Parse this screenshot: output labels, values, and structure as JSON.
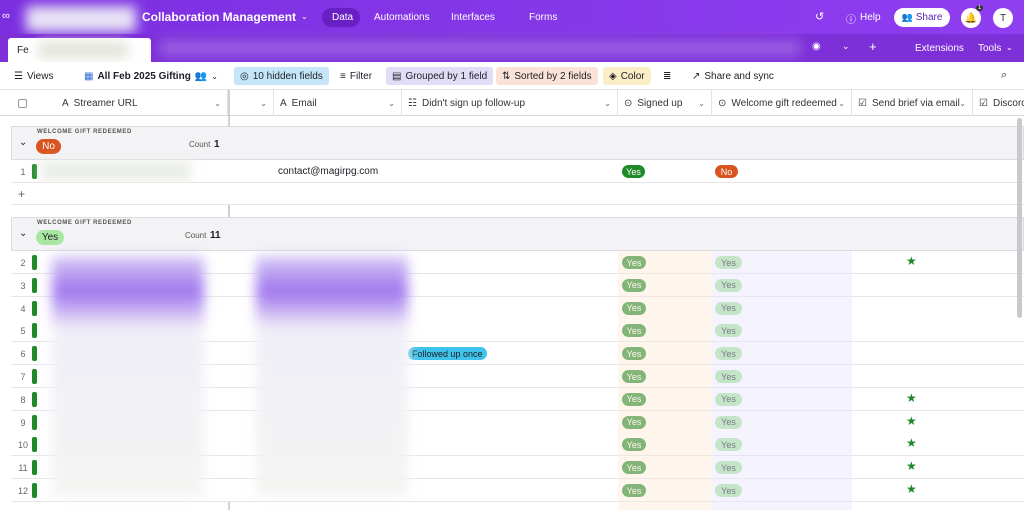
{
  "app": {
    "title": "Collaboration Management",
    "tab_first": "Fe"
  },
  "nav": {
    "data": "Data",
    "automations": "Automations",
    "interfaces": "Interfaces",
    "forms": "Forms",
    "help": "Help",
    "share": "Share",
    "avatar": "T",
    "notif_count": "1",
    "extensions": "Extensions",
    "tools": "Tools"
  },
  "toolbar": {
    "views": "Views",
    "view_name": "All Feb 2025 Gifting",
    "hidden": "10 hidden fields",
    "filter": "Filter",
    "grouped": "Grouped by 1 field",
    "sorted": "Sorted by 2 fields",
    "color": "Color",
    "share_sync": "Share and sync"
  },
  "columns": {
    "streamer": "Streamer URL",
    "email": "Email",
    "followup": "Didn't sign up follow-up",
    "signed": "Signed up",
    "welcome": "Welcome gift redeemed",
    "brief": "Send brief via email",
    "discord": "Discord"
  },
  "groups": [
    {
      "label": "WELCOME GIFT REDEEMED",
      "value": "No",
      "count_label": "Count",
      "count": "1"
    },
    {
      "label": "WELCOME GIFT REDEEMED",
      "value": "Yes",
      "count_label": "Count",
      "count": "11"
    }
  ],
  "row1": {
    "num": "1",
    "email": "contact@magirpg.com",
    "signed": "Yes",
    "welcome": "No"
  },
  "rows": [
    {
      "num": "2",
      "followup": "",
      "signed": "Yes",
      "welcome": "Yes",
      "brief": true
    },
    {
      "num": "3",
      "followup": "",
      "signed": "Yes",
      "welcome": "Yes",
      "brief": false
    },
    {
      "num": "4",
      "followup": "",
      "signed": "Yes",
      "welcome": "Yes",
      "brief": false
    },
    {
      "num": "5",
      "followup": "",
      "signed": "Yes",
      "welcome": "Yes",
      "brief": false
    },
    {
      "num": "6",
      "followup": "Followed up once",
      "signed": "Yes",
      "welcome": "Yes",
      "brief": false
    },
    {
      "num": "7",
      "followup": "",
      "signed": "Yes",
      "welcome": "Yes",
      "brief": false
    },
    {
      "num": "8",
      "followup": "",
      "signed": "Yes",
      "welcome": "Yes",
      "brief": true
    },
    {
      "num": "9",
      "followup": "",
      "signed": "Yes",
      "welcome": "Yes",
      "brief": true
    },
    {
      "num": "10",
      "followup": "",
      "signed": "Yes",
      "welcome": "Yes",
      "brief": true
    },
    {
      "num": "11",
      "followup": "",
      "signed": "Yes",
      "welcome": "Yes",
      "brief": true
    },
    {
      "num": "12",
      "followup": "",
      "signed": "Yes",
      "welcome": "Yes",
      "brief": true
    }
  ],
  "colors": {
    "topbar": "#8a38ea",
    "yes_dark": "#1f8a2a",
    "yes_light": "#a8e6a1",
    "no": "#d9541e",
    "followup": "#3fc3ea"
  }
}
